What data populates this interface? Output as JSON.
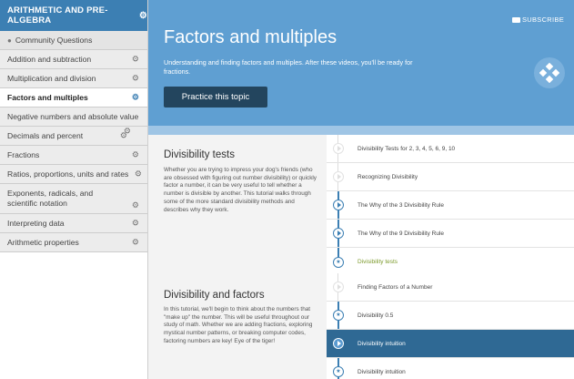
{
  "sidebar": {
    "header": "ARITHMETIC AND PRE-ALGEBRA",
    "community": "Community Questions",
    "items": [
      {
        "label": "Addition and subtraction"
      },
      {
        "label": "Multiplication and division"
      },
      {
        "label": "Factors and multiples"
      },
      {
        "label": "Negative numbers and absolute value"
      },
      {
        "label": "Decimals and percent"
      },
      {
        "label": "Fractions"
      },
      {
        "label": "Ratios, proportions, units and rates"
      },
      {
        "label": "Exponents, radicals, and scientific notation"
      },
      {
        "label": "Interpreting data"
      },
      {
        "label": "Arithmetic properties"
      }
    ],
    "active_index": 2
  },
  "banner": {
    "subscribe": "SUBSCRIBE",
    "title": "Factors and multiples",
    "description": "Understanding and finding factors and multiples. After these videos, you'll be ready for fractions.",
    "practice_button": "Practice this topic"
  },
  "tutorials": [
    {
      "title": "Divisibility tests",
      "description": "Whether you are trying to impress your dog's friends (who are obsessed with figuring out number divisibility) or quickly factor a number, it can be very useful to tell whether a number is divisible by another. This tutorial walks through some of the more standard divisibility methods and describes why they work.",
      "items": [
        {
          "label": "Divisibility Tests for 2, 3, 4, 5, 6, 9, 10",
          "type": "video",
          "state": "faded"
        },
        {
          "label": "Recognizing Divisibility",
          "type": "video",
          "state": "faded"
        },
        {
          "label": "The Why of the 3 Divisibility Rule",
          "type": "video",
          "state": "done"
        },
        {
          "label": "The Why of the 9 Divisibility Rule",
          "type": "video",
          "state": "done"
        },
        {
          "label": "Divisibility tests",
          "type": "exercise",
          "state": "done"
        }
      ]
    },
    {
      "title": "Divisibility and factors",
      "description": "In this tutorial, we'll begin to think about the numbers that \"make up\" the number. This will be useful throughout our study of math. Whether we are adding fractions, exploring mystical number patterns, or breaking computer codes, factoring numbers are key! Eye of the tiger!",
      "items": [
        {
          "label": "Finding Factors of a Number",
          "type": "video",
          "state": "faded"
        },
        {
          "label": "Divisibility 0.5",
          "type": "exercise",
          "state": "done"
        },
        {
          "label": "Divisibility intuition",
          "type": "video",
          "state": "selected"
        },
        {
          "label": "Divisibility intuition",
          "type": "exercise",
          "state": "done"
        }
      ]
    }
  ],
  "colors": {
    "accent": "#3c7fb3",
    "banner": "#5f9fd2",
    "button": "#23455e",
    "exercise_green": "#7c9a2c",
    "selected_row": "#2f6994"
  }
}
